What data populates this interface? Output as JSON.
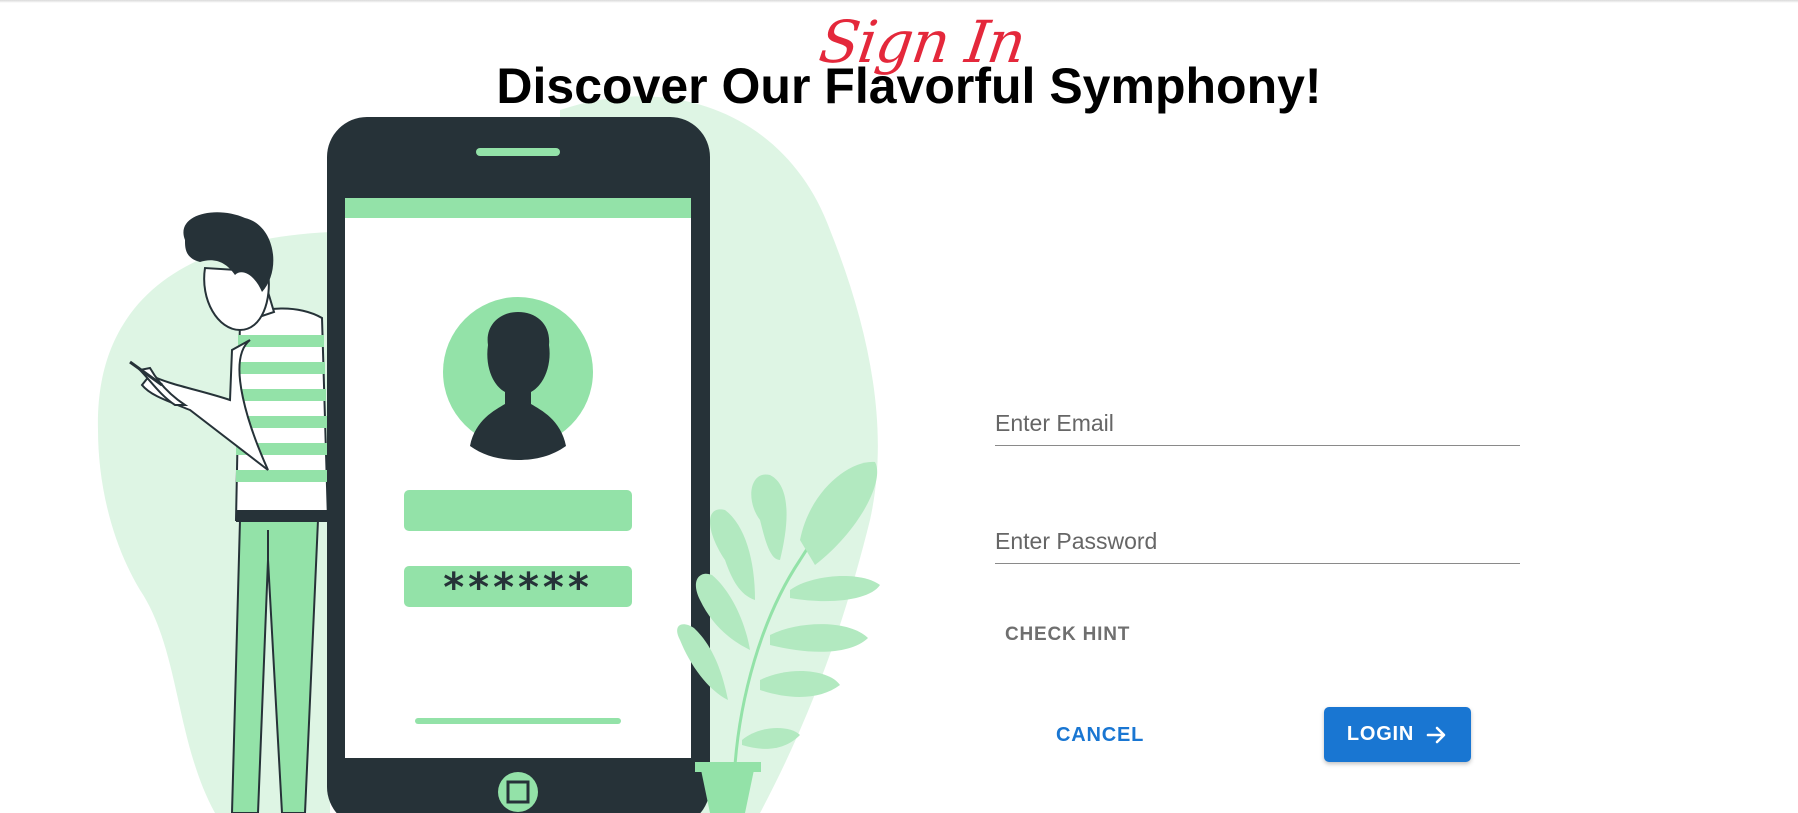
{
  "header": {
    "sign_in_label": "Sign In",
    "headline": "Discover Our Flavorful Symphony!"
  },
  "form": {
    "email_placeholder": "Enter Email",
    "email_value": "",
    "password_placeholder": "Enter Password",
    "password_value": "",
    "hint_label": "CHECK HINT",
    "cancel_label": "CANCEL",
    "login_label": "LOGIN",
    "login_icon": "arrow-right-icon"
  },
  "illustration": {
    "phone_password_mask": "******",
    "icons": [
      "person-icon",
      "avatar-icon",
      "plant-icon",
      "phone-home-icon"
    ]
  },
  "colors": {
    "accent": "#1976d2",
    "script_title": "#e4283b",
    "illustration_green": "#93e2a8",
    "illustration_light_green": "#def5e4",
    "illustration_dark": "#263238"
  }
}
